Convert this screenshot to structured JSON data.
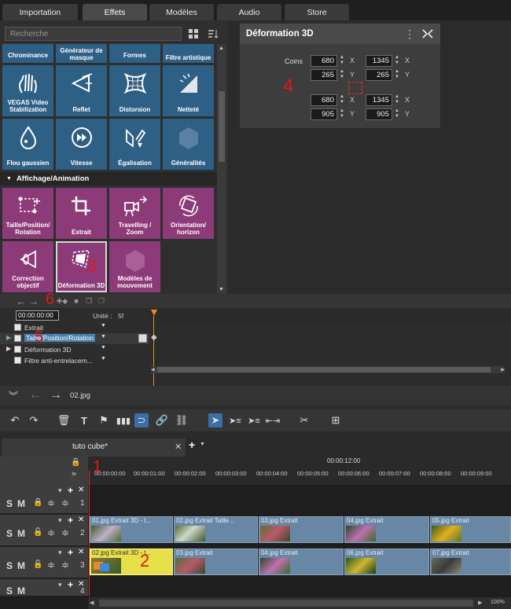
{
  "tabs": [
    "Importation",
    "Effets",
    "Modèles",
    "Audio",
    "Store"
  ],
  "search": {
    "placeholder": "Recherche"
  },
  "effects_top_row": [
    "Chrominance",
    "Générateur de masque",
    "Formes",
    "Filtre artistique"
  ],
  "effects_row1": [
    "VEGAS Video Stabilization",
    "Reflet",
    "Distorsion",
    "Netteté"
  ],
  "effects_row2": [
    "Flou gaussien",
    "Vitesse",
    "Égalisation",
    "Généralités"
  ],
  "category": "Affichage/Animation",
  "anim_row1": [
    "Taille/Position/ Rotation",
    "Extrait",
    "Travelling / Zoom",
    "Orientation/ horizon"
  ],
  "anim_row2": [
    "Correction objectif",
    "Déformation 3D",
    "Modèles de mouvement"
  ],
  "deform": {
    "title": "Déformation 3D",
    "corners_label": "Coins",
    "v1": "680",
    "v2": "1345",
    "v3": "265",
    "v4": "265",
    "v5": "680",
    "v6": "1345",
    "v7": "905",
    "v8": "905",
    "x": "X",
    "y": "Y"
  },
  "annotations": {
    "n1": "1",
    "n2": "2",
    "n3": "3",
    "n4": "4",
    "n5": "5",
    "n6": "6"
  },
  "keyframes": {
    "time": "00:00:00:00",
    "unit": "Unité :",
    "unit_val": "5f",
    "tracks": [
      "Extrait",
      "Taille/Position/Rotation",
      "Déformation 3D",
      "Filtre anti-entrelacem..."
    ]
  },
  "nav": {
    "file": "02.jpg"
  },
  "project_tab": "tuto cube*",
  "timeline": {
    "ruler_top": "00:00:12:00",
    "ticks": [
      "00:00:00:00",
      "00:00:01:00",
      "00:00:02:00",
      "00:00:03:00",
      "00:00:04:00",
      "00:00:05:00",
      "00:00:06:00",
      "00:00:07:00",
      "00:00:08:00",
      "00:00:09:00"
    ],
    "track_numbers": [
      "1",
      "2",
      "3",
      "4"
    ],
    "s": "S",
    "m": "M",
    "track2_clips": [
      "01.jpg  Extrait 3D - t...",
      "02.jpg  Extrait  Taille...",
      "03.jpg  Extrait",
      "04.jpg  Extrait",
      "05.jpg  Extrait"
    ],
    "track3_clips": [
      "02.jpg  Extrait 3D - t...",
      "03.jpg  Extrait",
      "04.jpg  Extrait",
      "06.jpg  Extrait",
      "07.jpg  Extrait"
    ]
  },
  "zoom": "100%"
}
